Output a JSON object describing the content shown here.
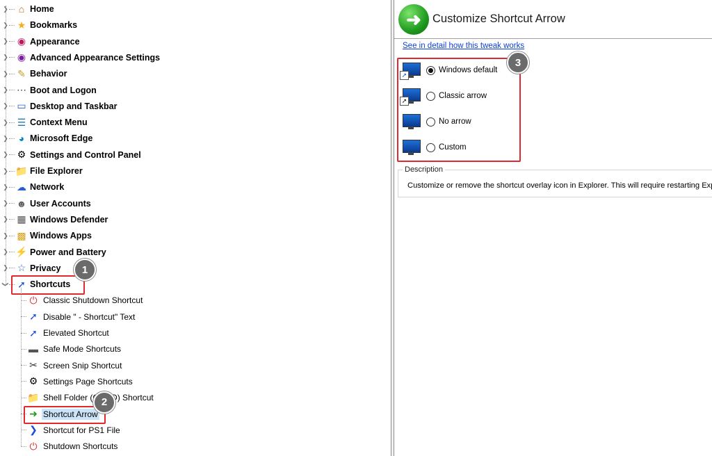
{
  "tree": {
    "top_items": [
      {
        "label": "Home",
        "icon": "home-icon"
      },
      {
        "label": "Bookmarks",
        "icon": "star-icon"
      },
      {
        "label": "Appearance",
        "icon": "palette-icon"
      },
      {
        "label": "Advanced Appearance Settings",
        "icon": "palette-advanced-icon"
      },
      {
        "label": "Behavior",
        "icon": "behavior-icon"
      },
      {
        "label": "Boot and Logon",
        "icon": "loading-dots-icon"
      },
      {
        "label": "Desktop and Taskbar",
        "icon": "desktop-icon"
      },
      {
        "label": "Context Menu",
        "icon": "context-menu-icon"
      },
      {
        "label": "Microsoft Edge",
        "icon": "edge-icon"
      },
      {
        "label": "Settings and Control Panel",
        "icon": "gear-icon"
      },
      {
        "label": "File Explorer",
        "icon": "file-explorer-icon"
      },
      {
        "label": "Network",
        "icon": "network-icon"
      },
      {
        "label": "User Accounts",
        "icon": "users-icon"
      },
      {
        "label": "Windows Defender",
        "icon": "defender-icon"
      },
      {
        "label": "Windows Apps",
        "icon": "apps-icon"
      },
      {
        "label": "Power and Battery",
        "icon": "battery-icon"
      },
      {
        "label": "Privacy",
        "icon": "shield-icon"
      }
    ],
    "shortcuts": {
      "label": "Shortcuts",
      "icon": "shortcut-icon"
    },
    "children": [
      {
        "label": "Classic Shutdown Shortcut",
        "icon": "shutdown-icon"
      },
      {
        "label": "Disable \" - Shortcut\" Text",
        "icon": "shortcut-icon"
      },
      {
        "label": "Elevated Shortcut",
        "icon": "elevated-shortcut-icon"
      },
      {
        "label": "Safe Mode Shortcuts",
        "icon": "safe-mode-icon"
      },
      {
        "label": "Screen Snip Shortcut",
        "icon": "scissors-icon"
      },
      {
        "label": "Settings Page Shortcuts",
        "icon": "gear-icon"
      },
      {
        "label": "Shell Folder (CLSID) Shortcut",
        "icon": "folder-icon"
      },
      {
        "label": "Shortcut Arrow",
        "icon": "green-arrow-icon"
      },
      {
        "label": "Shortcut for PS1 File",
        "icon": "powershell-icon"
      },
      {
        "label": "Shutdown Shortcuts",
        "icon": "shutdown-icon"
      }
    ],
    "selected": "Shortcut Arrow"
  },
  "callouts": {
    "one": "1",
    "two": "2",
    "three": "3"
  },
  "panel": {
    "title": "Customize Shortcut Arrow",
    "link": "See in detail how this tweak works",
    "options": [
      {
        "label": "Windows default",
        "checked": true,
        "overlay": "small-arrow"
      },
      {
        "label": "Classic arrow",
        "checked": false,
        "overlay": "classic-arrow"
      },
      {
        "label": "No arrow",
        "checked": false,
        "overlay": "none"
      },
      {
        "label": "Custom",
        "checked": false,
        "overlay": "none"
      }
    ],
    "description": {
      "legend": "Description",
      "text": "Customize or remove the shortcut overlay icon in Explorer. This will require restarting Explorer."
    }
  },
  "colors": {
    "highlight_red": "#e0292f",
    "link_blue": "#0b3fd6",
    "selection": "#cce4f7"
  }
}
